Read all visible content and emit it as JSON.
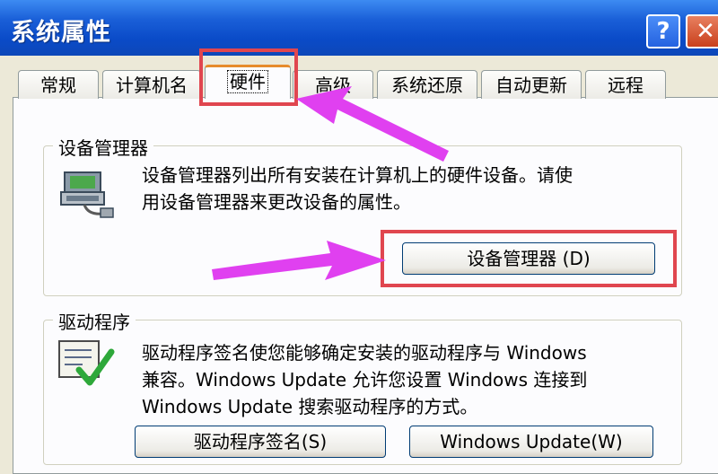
{
  "window": {
    "title": "系统属性",
    "help_label": "?",
    "close_label": "✕"
  },
  "tabs": [
    {
      "label": "常规"
    },
    {
      "label": "计算机名"
    },
    {
      "label": "硬件",
      "active": true
    },
    {
      "label": "高级"
    },
    {
      "label": "系统还原"
    },
    {
      "label": "自动更新"
    },
    {
      "label": "远程"
    }
  ],
  "device_manager": {
    "group_title": "设备管理器",
    "description": "设备管理器列出所有安装在计算机上的硬件设备。请使\n用设备管理器来更改设备的属性。",
    "button_label": "设备管理器 (D)",
    "icon": "device-manager-icon"
  },
  "drivers": {
    "group_title": "驱动程序",
    "description": "驱动程序签名使您能够确定安装的驱动程序与 Windows\n兼容。Windows Update 允许您设置 Windows 连接到\nWindows Update 搜索驱动程序的方式。",
    "sign_button_label": "驱动程序签名(S)",
    "update_button_label": "Windows Update(W)",
    "icon": "driver-signing-icon"
  },
  "annotation": {
    "highlight_color": "#e0464f",
    "arrow_color": "#e040f0"
  }
}
